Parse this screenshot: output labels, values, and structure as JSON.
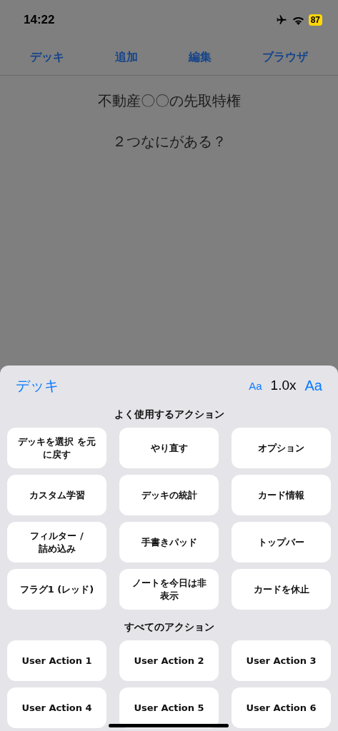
{
  "status_bar": {
    "time": "14:22",
    "airplane_mode": true,
    "battery": "87"
  },
  "nav": [
    {
      "label": "デッキ"
    },
    {
      "label": "追加"
    },
    {
      "label": "編集"
    },
    {
      "label": "ブラウザ"
    }
  ],
  "card": {
    "lines": [
      "不動産〇〇の先取特権",
      "２つなにがある？"
    ]
  },
  "sheet": {
    "title": "デッキ",
    "font_small": "Aa",
    "zoom": "1.0x",
    "font_large": "Aa",
    "sections": [
      {
        "title": "よく使用するアクション",
        "actions": [
          "デッキを選択 を元に戻す",
          "やり直す",
          "オプション",
          "カスタム学習",
          "デッキの統計",
          "カード情報",
          "フィルター /\n詰め込み",
          "手書きパッド",
          "トップバー",
          "フラグ1 (レッド)",
          "ノートを今日は非表示",
          "カードを休止"
        ]
      },
      {
        "title": "すべてのアクション",
        "actions": [
          "User Action 1",
          "User Action 2",
          "User Action 3",
          "User Action 4",
          "User Action 5",
          "User Action 6"
        ]
      }
    ]
  }
}
